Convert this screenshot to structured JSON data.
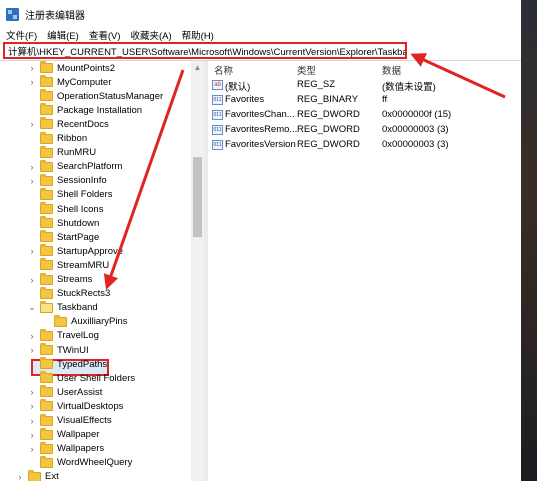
{
  "window": {
    "title": "注册表编辑器"
  },
  "menu": [
    "文件(F)",
    "编辑(E)",
    "查看(V)",
    "收藏夹(A)",
    "帮助(H)"
  ],
  "address": "计算机\\HKEY_CURRENT_USER\\Software\\Microsoft\\Windows\\CurrentVersion\\Explorer\\Taskband",
  "tree": [
    {
      "label": "MountPoints2",
      "expander": ">"
    },
    {
      "label": "MyComputer",
      "expander": ">"
    },
    {
      "label": "OperationStatusManager",
      "expander": ""
    },
    {
      "label": "Package Installation",
      "expander": ""
    },
    {
      "label": "RecentDocs",
      "expander": ">"
    },
    {
      "label": "Ribbon",
      "expander": ""
    },
    {
      "label": "RunMRU",
      "expander": ""
    },
    {
      "label": "SearchPlatform",
      "expander": ">"
    },
    {
      "label": "SessionInfo",
      "expander": ">"
    },
    {
      "label": "Shell Folders",
      "expander": ""
    },
    {
      "label": "Shell Icons",
      "expander": ""
    },
    {
      "label": "Shutdown",
      "expander": ""
    },
    {
      "label": "StartPage",
      "expander": ""
    },
    {
      "label": "StartupApprove",
      "expander": ">"
    },
    {
      "label": "StreamMRU",
      "expander": ""
    },
    {
      "label": "Streams",
      "expander": ">"
    },
    {
      "label": "StuckRects3",
      "expander": ""
    },
    {
      "label": "Taskband",
      "expander": "v"
    },
    {
      "label": "AuxilliaryPins",
      "expander": ""
    },
    {
      "label": "TravelLog",
      "expander": ">"
    },
    {
      "label": "TWinUI",
      "expander": ">"
    },
    {
      "label": "TypedPaths",
      "expander": ""
    },
    {
      "label": "User Shell Folders",
      "expander": ""
    },
    {
      "label": "UserAssist",
      "expander": ">"
    },
    {
      "label": "VirtualDesktops",
      "expander": ">"
    },
    {
      "label": "VisualEffects",
      "expander": ">"
    },
    {
      "label": "Wallpaper",
      "expander": ">"
    },
    {
      "label": "Wallpapers",
      "expander": ">"
    },
    {
      "label": "WordWheelQuery",
      "expander": ""
    },
    {
      "label": "Ext",
      "expander": ">"
    }
  ],
  "values": {
    "headers": {
      "name": "名称",
      "type": "类型",
      "data": "数据"
    },
    "rows": [
      {
        "name": "(默认)",
        "type": "REG_SZ",
        "data": "(数值未设置)",
        "icon": "string-value-icon",
        "icon_text": "ab"
      },
      {
        "name": "Favorites",
        "type": "REG_BINARY",
        "data": "ff",
        "icon": "binary-value-icon",
        "icon_text": "011"
      },
      {
        "name": "FavoritesChan...",
        "type": "REG_DWORD",
        "data": "0x0000000f (15)",
        "icon": "binary-value-icon",
        "icon_text": "011"
      },
      {
        "name": "FavoritesRemo...",
        "type": "REG_DWORD",
        "data": "0x00000003 (3)",
        "icon": "binary-value-icon",
        "icon_text": "011"
      },
      {
        "name": "FavoritesVersion",
        "type": "REG_DWORD",
        "data": "0x00000003 (3)",
        "icon": "binary-value-icon",
        "icon_text": "011"
      }
    ]
  },
  "annotation_color": "#e02424",
  "selected_tree_item": "Taskband"
}
